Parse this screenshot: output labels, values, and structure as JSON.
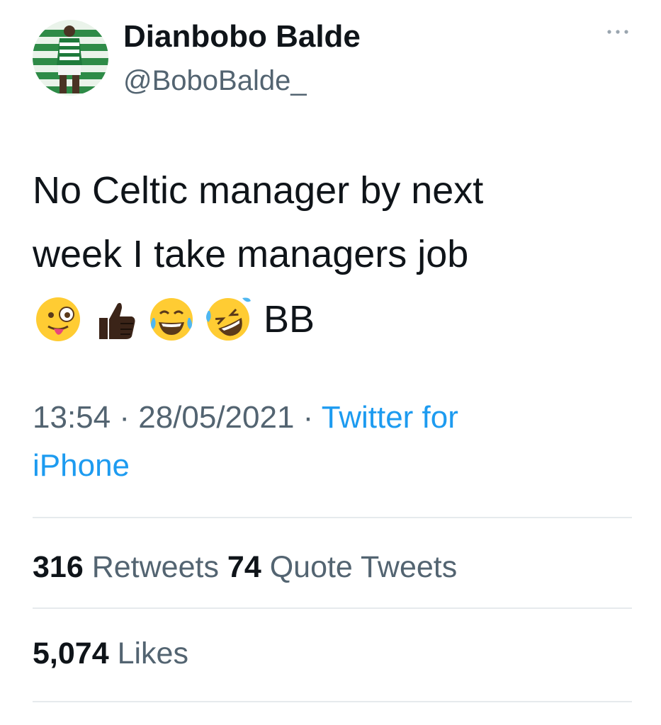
{
  "tweet": {
    "author": {
      "display_name": "Dianbobo Balde",
      "handle": "@BoboBalde_",
      "avatar": "avatar-photo"
    },
    "text_lines": [
      "No Celtic manager by next",
      "week I take managers job"
    ],
    "emojis": [
      "winking-face-with-tongue-emoji",
      "thumbs-up-emoji",
      "face-with-tears-of-joy-emoji",
      "rolling-on-floor-laughing-emoji"
    ],
    "signature": "BB",
    "time": "13:54",
    "date": "28/05/2021",
    "separator": " · ",
    "source_line1": "Twitter for",
    "source_line2": "iPhone",
    "more_icon": "more-icon",
    "stats": {
      "retweets_count": "316",
      "retweets_label": "Retweets",
      "quotes_count": "74",
      "quotes_label": "Quote Tweets",
      "likes_count": "5,074",
      "likes_label": "Likes"
    }
  },
  "colors": {
    "text": "#0f1419",
    "secondary": "#536471",
    "link": "#1d9bf0",
    "divider": "#e6eaed"
  }
}
